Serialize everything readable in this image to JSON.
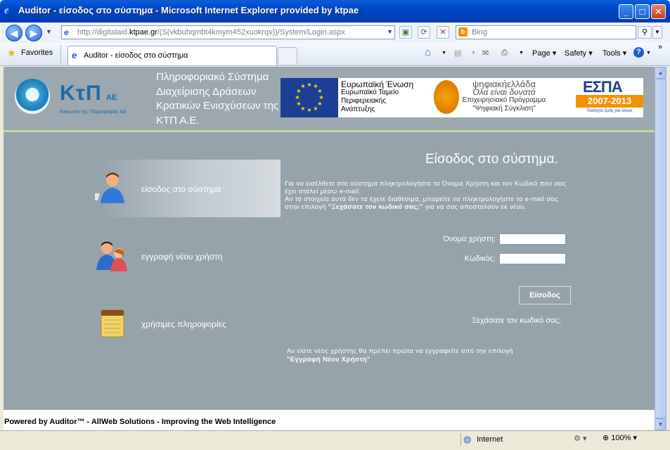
{
  "window": {
    "title": "Auditor - είσοδος στο σύστημα - Microsoft Internet Explorer provided by ktpae",
    "min": "_",
    "max": "□",
    "close": "✕"
  },
  "addressbar": {
    "url_prefix": "http://digitalaid.",
    "url_domain": "ktpae.gr",
    "url_rest": "/(S(vkbuhqmbt4kmym452xuokrqv))/System/Login.aspx",
    "search_placeholder": "Bing"
  },
  "favorites": {
    "label": "Favorites",
    "tab_title": "Auditor - είσοδος στο σύστημα"
  },
  "commandbar": {
    "page": "Page",
    "safety": "Safety",
    "tools": "Tools"
  },
  "header": {
    "logo_text": "ΚτΠ",
    "logo_ae": "ΑΕ",
    "logo_sub": "Κοινωνία της Πληροφορίας ΑΕ",
    "system_title": "Πληροφοριακό Σύστημα Διαχείρισης Δράσεων Κρατικών Ενισχύσεων της ΚΤΠ Α.Ε.",
    "eu_title": "Ευρωπαϊκή Ένωση",
    "eu_line1": "Ευρωπαϊκό Ταμείο",
    "eu_line2": "Περιφερειακής",
    "eu_line3": "Ανάπτυξης",
    "ps_brand": "ψηφιακήελλάδα",
    "ps_slogan": "Όλα είναι δυνατά",
    "ps_line1": "Επιχειρησιακό Πρόγραμμα",
    "ps_line2": "\"Ψηφιακή Σύγκλιση\"",
    "espa_title": "ΕΣΠΑ",
    "espa_years": "2007-2013",
    "espa_sub": "Ποιότητα ζωής για όλους"
  },
  "menu": {
    "login": "είσοδος στο σύστημα",
    "register": "εγγραφή νέου χρήστη",
    "info": "χρήσιμες πληροφορίες"
  },
  "form": {
    "title": "Είσοδος στο σύστημα.",
    "intro1": "Για να εισέλθετε στο σύστημα πληκτρολογήστε το Όνομα Χρήστη και τον Κωδικό που σας έχει σταλεί μέσω e-mail.",
    "intro2": "Αν τα στοιχεία αυτά δεν τα έχετε διαθέσιμα, μπορείτε να πληκτρολογήστε το e-mail σας στην επιλογή",
    "intro_link": "\"Ξεχάσατε τον κωδικό σας;\"",
    "intro3": "για να σας αποσταλούν εκ νέου.",
    "username_label": "Όνομα χρήστη:",
    "password_label": "Κωδικός:",
    "username_value": "",
    "password_value": "",
    "login_button": "Είσοδος",
    "forgot_link": "Ξεχάσατε τον κωδικό σας;",
    "newuser_text": "Αν είστε νέος χρήστης θα πρέπει πρώτα να εγγραφείτε από την επιλογή",
    "newuser_link": "\"Εγγραφή Νέου Χρήστη\""
  },
  "footer": {
    "text": "Powered by Auditor™ - AllWeb Solutions - Improving the Web Intelligence"
  },
  "status": {
    "zone": "Internet",
    "zoom": "100%"
  }
}
